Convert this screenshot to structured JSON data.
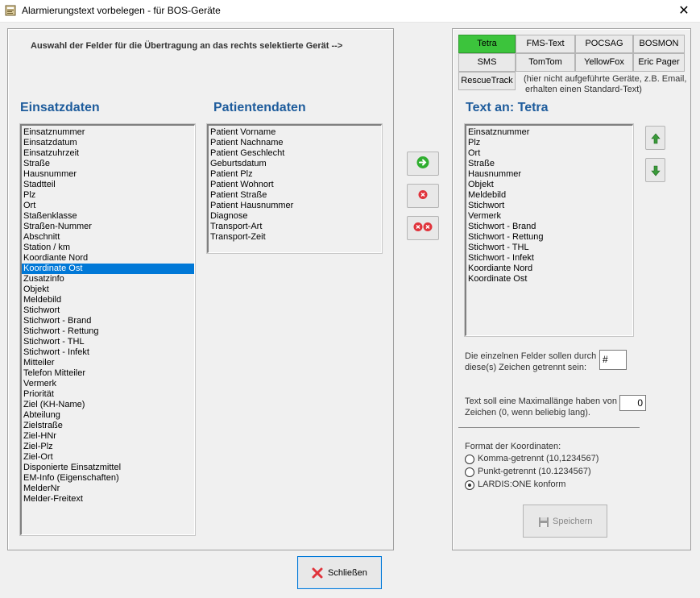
{
  "window": {
    "title": "Alarmierungstext vorbelegen - für BOS-Geräte",
    "close_glyph": "✕"
  },
  "left_panel": {
    "hint": "Auswahl der Felder für die Übertragung an das rechts selektierte Gerät  -->",
    "einsatz_heading": "Einsatzdaten",
    "patient_heading": "Patientendaten",
    "einsatz_items": [
      "Einsatznummer",
      "Einsatzdatum",
      "Einsatzuhrzeit",
      "Straße",
      "Hausnummer",
      "Stadtteil",
      "Plz",
      "Ort",
      "Staßenklasse",
      "Straßen-Nummer",
      "Abschnitt",
      "Station / km",
      "Koordiante Nord",
      "Koordinate Ost",
      "Zusatzinfo",
      "Objekt",
      "Meldebild",
      "Stichwort",
      "Stichwort - Brand",
      "Stichwort - Rettung",
      "Stichwort - THL",
      "Stichwort - Infekt",
      "Mitteiler",
      "Telefon Mitteiler",
      "Vermerk",
      "Priorität",
      "Ziel (KH-Name)",
      "Abteilung",
      "Zielstraße",
      "Ziel-HNr",
      "Ziel-Plz",
      "Ziel-Ort",
      "Disponierte Einsatzmittel",
      "EM-Info (Eigenschaften)",
      "MelderNr",
      "Melder-Freitext"
    ],
    "einsatz_selected": "Koordinate Ost",
    "patient_items": [
      "Patient Vorname",
      "Patient Nachname",
      "Patient Geschlecht",
      "Geburtsdatum",
      "Patient Plz",
      "Patient Wohnort",
      "Patient Straße",
      "Patient Hausnummer",
      "Diagnose",
      "Transport-Art",
      "Transport-Zeit"
    ]
  },
  "middle_buttons": {
    "add_icon": "arrow-right-icon",
    "remove_icon": "remove-icon",
    "remove_all_icon": "remove-all-icon"
  },
  "right_panel": {
    "tabs": [
      {
        "label": "Tetra",
        "active": true
      },
      {
        "label": "FMS-Text",
        "active": false
      },
      {
        "label": "POCSAG",
        "active": false
      },
      {
        "label": "BOSMON",
        "active": false
      },
      {
        "label": "SMS",
        "active": false
      },
      {
        "label": "TomTom",
        "active": false
      },
      {
        "label": "YellowFox",
        "active": false
      },
      {
        "label": "Eric Pager",
        "active": false
      },
      {
        "label": "RescueTrack",
        "active": false
      }
    ],
    "tabs_note_line1": "(hier nicht aufgeführte Geräte, z.B. Email,",
    "tabs_note_line2": "erhalten einen Standard-Text)",
    "text_heading": "Text an: Tetra",
    "selected_items": [
      "Einsatznummer",
      "Plz",
      "Ort",
      "Straße",
      "Hausnummer",
      "Objekt",
      "Meldebild",
      "Stichwort",
      "Vermerk",
      "Stichwort - Brand",
      "Stichwort - Rettung",
      "Stichwort - THL",
      "Stichwort - Infekt",
      "Koordiante Nord",
      "Koordinate Ost"
    ],
    "separator_label_line1": "Die einzelnen Felder sollen durch",
    "separator_label_line2": "diese(s) Zeichen getrennt sein:",
    "separator_value": "#",
    "maxlen_label_line1": "Text soll eine Maximallänge haben von",
    "maxlen_label_line2": "Zeichen (0, wenn beliebig lang).",
    "maxlen_value": "0",
    "coord_format_label": "Format der Koordinaten:",
    "coord_options": [
      {
        "label": "Komma-getrennt (10,1234567)",
        "checked": false
      },
      {
        "label": "Punkt-getrennt   (10.1234567)",
        "checked": false
      },
      {
        "label": "LARDIS:ONE konform",
        "checked": true
      }
    ],
    "save_label": "Speichern"
  },
  "footer": {
    "close_label": "Schließen"
  },
  "colors": {
    "heading_blue": "#1e5c9c",
    "tab_active_green": "#3cc43c",
    "selection_blue": "#0078d7"
  }
}
